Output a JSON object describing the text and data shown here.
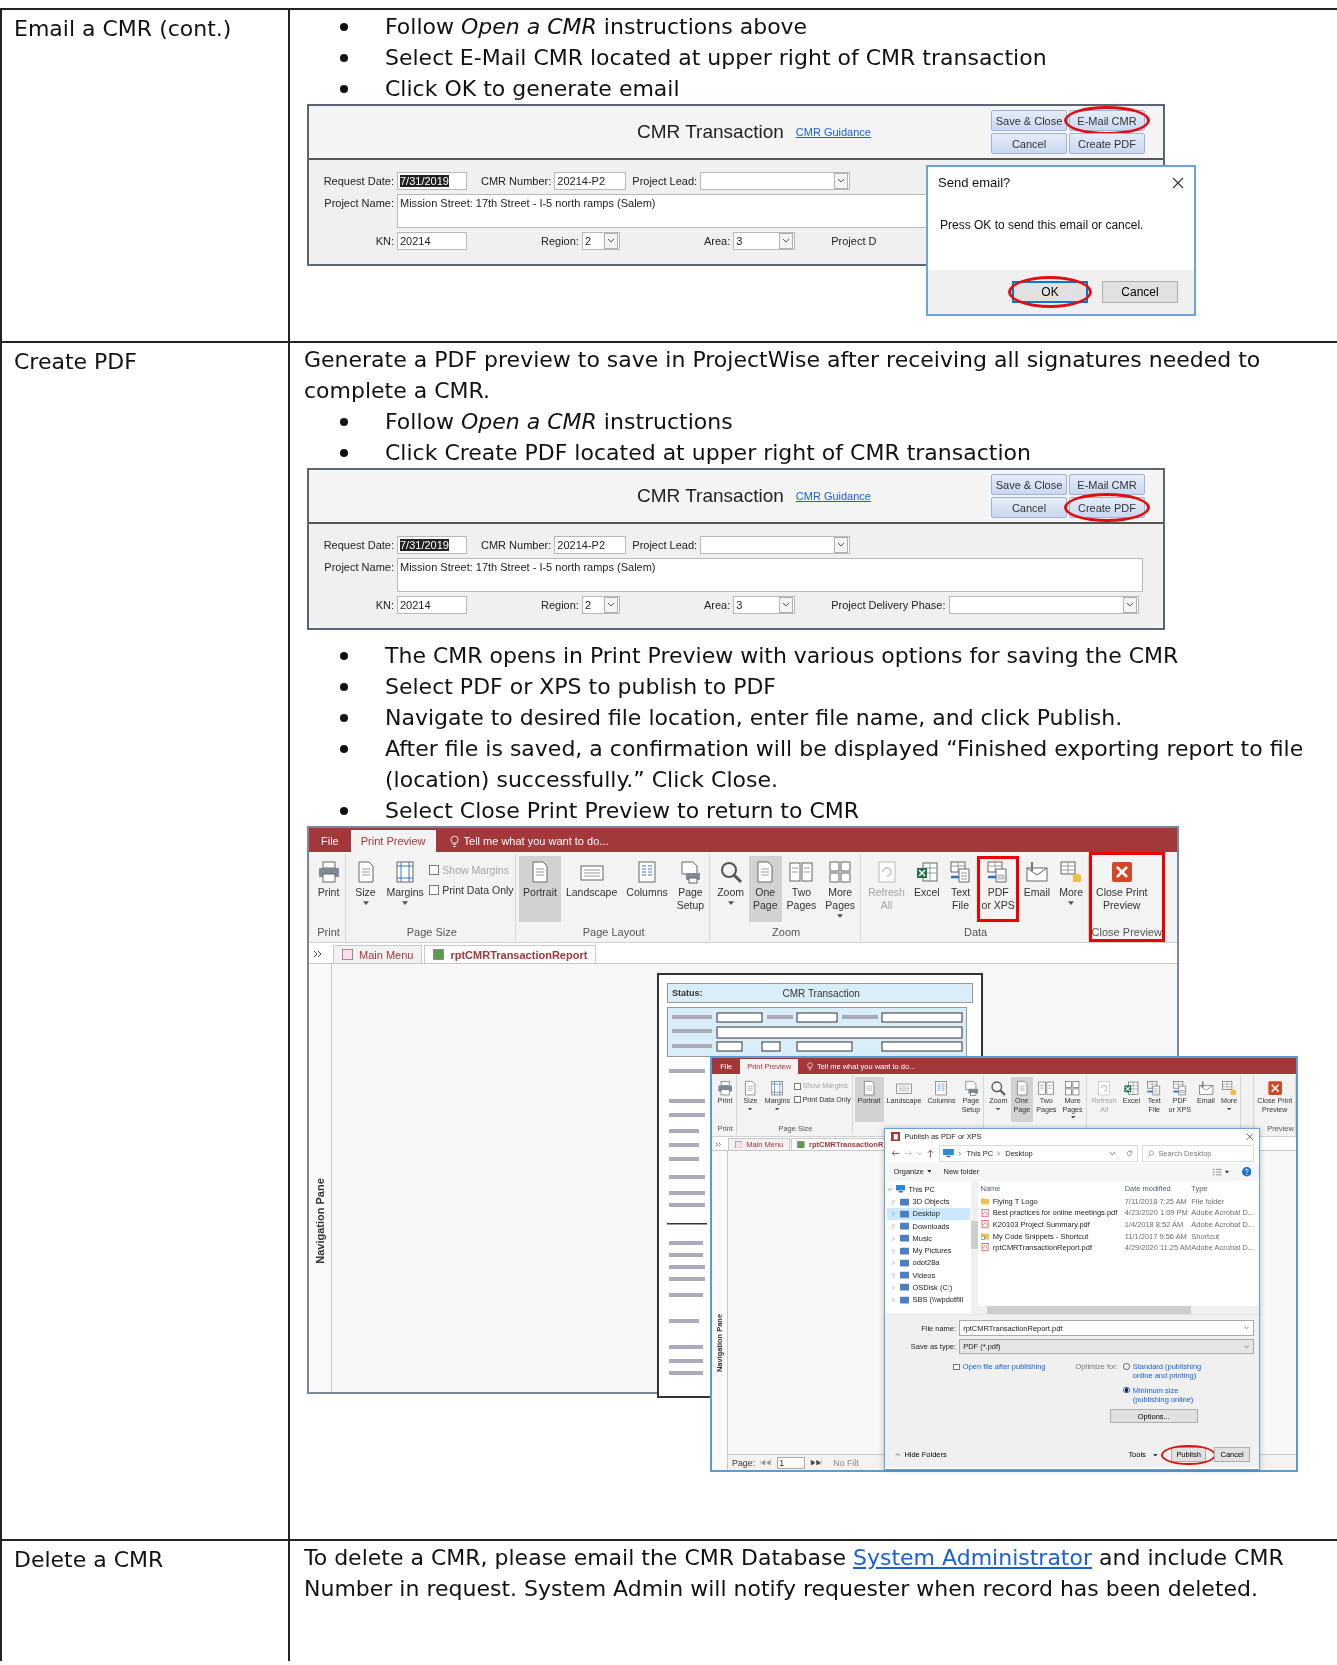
{
  "rows": [
    {
      "label": "Email a CMR (cont.)",
      "blocks": [
        {
          "kind": "bullets",
          "items": [
            "Follow *Open a CMR* instructions above",
            "Select E-Mail CMR located at upper right of CMR transaction",
            "Click OK to generate email"
          ]
        },
        {
          "kind": "form",
          "form": {
            "title": "CMR Transaction",
            "guidance": "CMR Guidance",
            "buttons": [
              {
                "label": "Save & Close",
                "circled": false
              },
              {
                "label": "E-Mail CMR",
                "circled": true
              },
              {
                "label": "Cancel",
                "circled": false
              },
              {
                "label": "Create PDF",
                "circled": false
              }
            ],
            "rows": [
              [
                {
                  "label": "Request Date:",
                  "kind": "text",
                  "value": "7/31/2019",
                  "selected": true
                },
                {
                  "label": "CMR Number:",
                  "kind": "text",
                  "value": "20214-P2",
                  "selected": false
                },
                {
                  "label": "Project Lead:",
                  "kind": "combo"
                }
              ],
              [
                {
                  "label": "Project Name:",
                  "kind": "memo",
                  "value": "Mission Street: 17th Street - I-5 north ramps (Salem)"
                }
              ],
              [
                {
                  "label": "KN:",
                  "kind": "text",
                  "value": "20214",
                  "selected": false
                },
                {
                  "label": "Region:",
                  "kind": "combo",
                  "value": "2"
                },
                {
                  "label": "Area:",
                  "kind": "combo",
                  "value": "3"
                },
                {
                  "label": "Project D",
                  "kind": "label"
                }
              ]
            ]
          },
          "dialog": {
            "title": "Send email?",
            "message": "Press OK to send this email or cancel.",
            "buttons": [
              {
                "label": "OK",
                "circled": true,
                "default": true
              },
              {
                "label": "Cancel",
                "circled": false,
                "default": false
              }
            ]
          }
        }
      ]
    },
    {
      "label": "Create PDF",
      "blocks": [
        {
          "kind": "paragraph",
          "text": "Generate a PDF preview to save in ProjectWise after receiving all signatures needed to complete a CMR."
        },
        {
          "kind": "bullets",
          "items": [
            "Follow *Open a CMR* instructions",
            "Click Create PDF located at upper right of CMR transaction"
          ]
        },
        {
          "kind": "form",
          "form": {
            "title": "CMR Transaction",
            "guidance": "CMR Guidance",
            "buttons": [
              {
                "label": "Save & Close",
                "circled": false
              },
              {
                "label": "E-Mail CMR",
                "circled": false
              },
              {
                "label": "Cancel",
                "circled": false
              },
              {
                "label": "Create PDF",
                "circled": true
              }
            ],
            "rows": [
              [
                {
                  "label": "Request Date:",
                  "kind": "text",
                  "value": "7/31/2019",
                  "selected": true
                },
                {
                  "label": "CMR Number:",
                  "kind": "text",
                  "value": "20214-P2",
                  "selected": false
                },
                {
                  "label": "Project Lead:",
                  "kind": "combo"
                }
              ],
              [
                {
                  "label": "Project Name:",
                  "kind": "memo",
                  "value": "Mission Street: 17th Street - I-5 north ramps (Salem)"
                }
              ],
              [
                {
                  "label": "KN:",
                  "kind": "text",
                  "value": "20214",
                  "selected": false
                },
                {
                  "label": "Region:",
                  "kind": "combo",
                  "value": "2"
                },
                {
                  "label": "Area:",
                  "kind": "combo",
                  "value": "3"
                },
                {
                  "label": "Project Delivery Phase:",
                  "kind": "combo"
                }
              ]
            ]
          }
        },
        {
          "kind": "bullets",
          "items": [
            "The CMR opens in Print Preview with various options for saving the CMR",
            "Select PDF or XPS to publish to PDF",
            "Navigate to desired file location, enter file name, and click Publish.",
            "After file is saved, a confirmation will be displayed “Finished exporting report to file (location) successfully.” Click Close.",
            "Select Close Print Preview to return to CMR"
          ]
        },
        {
          "kind": "preview",
          "windows": [
            {
              "tabs": [
                {
                  "label": "File",
                  "selected": false
                },
                {
                  "label": "Print Preview",
                  "selected": true
                }
              ],
              "tell_me": "Tell me what you want to do...",
              "groups": [
                {
                  "label": "Print",
                  "highlighted": false,
                  "buttons": [
                    {
                      "kind": "button",
                      "label": "Print",
                      "selected": false,
                      "disabled": false,
                      "highlighted": false,
                      "dropdown": false
                    }
                  ]
                },
                {
                  "label": "Page Size",
                  "highlighted": false,
                  "buttons": [
                    {
                      "kind": "button",
                      "label": "Size",
                      "selected": false,
                      "disabled": false,
                      "highlighted": false,
                      "dropdown": true
                    },
                    {
                      "kind": "button",
                      "label": "Margins",
                      "selected": false,
                      "disabled": false,
                      "highlighted": false,
                      "dropdown": true
                    },
                    {
                      "kind": "checkbox",
                      "label": "Show Margins",
                      "checked": false,
                      "disabled": true
                    },
                    {
                      "kind": "checkbox",
                      "label": "Print Data Only",
                      "checked": false,
                      "disabled": false
                    }
                  ]
                },
                {
                  "label": "Page Layout",
                  "highlighted": false,
                  "buttons": [
                    {
                      "kind": "button",
                      "label": "Portrait",
                      "selected": true,
                      "disabled": false,
                      "highlighted": false,
                      "dropdown": false
                    },
                    {
                      "kind": "button",
                      "label": "Landscape",
                      "selected": false,
                      "disabled": false,
                      "highlighted": false,
                      "dropdown": false
                    },
                    {
                      "kind": "button",
                      "label": "Columns",
                      "selected": false,
                      "disabled": false,
                      "highlighted": false,
                      "dropdown": false
                    },
                    {
                      "kind": "button",
                      "label": "Page\nSetup",
                      "selected": false,
                      "disabled": false,
                      "highlighted": false,
                      "dropdown": false
                    }
                  ]
                },
                {
                  "label": "Zoom",
                  "highlighted": false,
                  "buttons": [
                    {
                      "kind": "button",
                      "label": "Zoom",
                      "selected": false,
                      "disabled": false,
                      "highlighted": false,
                      "dropdown": true
                    },
                    {
                      "kind": "button",
                      "label": "One\nPage",
                      "selected": true,
                      "disabled": false,
                      "highlighted": false,
                      "dropdown": false
                    },
                    {
                      "kind": "button",
                      "label": "Two\nPages",
                      "selected": false,
                      "disabled": false,
                      "highlighted": false,
                      "dropdown": false
                    },
                    {
                      "kind": "button",
                      "label": "More\nPages",
                      "selected": false,
                      "disabled": false,
                      "highlighted": false,
                      "dropdown": true
                    }
                  ]
                },
                {
                  "label": "Data",
                  "highlighted": false,
                  "buttons": [
                    {
                      "kind": "button",
                      "label": "Refresh\nAll",
                      "selected": false,
                      "disabled": true,
                      "highlighted": false,
                      "dropdown": false
                    },
                    {
                      "kind": "button",
                      "label": "Excel",
                      "selected": false,
                      "disabled": false,
                      "highlighted": false,
                      "dropdown": false
                    },
                    {
                      "kind": "button",
                      "label": "Text\nFile",
                      "selected": false,
                      "disabled": false,
                      "highlighted": false,
                      "dropdown": false
                    },
                    {
                      "kind": "button",
                      "label": "PDF\nor XPS",
                      "selected": false,
                      "disabled": false,
                      "highlighted": true,
                      "dropdown": false
                    },
                    {
                      "kind": "button",
                      "label": "Email",
                      "selected": false,
                      "disabled": false,
                      "highlighted": false,
                      "dropdown": false
                    },
                    {
                      "kind": "button",
                      "label": "More",
                      "selected": false,
                      "disabled": false,
                      "highlighted": false,
                      "dropdown": true
                    }
                  ]
                },
                {
                  "label": "Close Preview",
                  "highlighted": true,
                  "buttons": [
                    {
                      "kind": "button",
                      "label": "Close Print\nPreview",
                      "selected": false,
                      "disabled": false,
                      "highlighted": false,
                      "dropdown": false
                    }
                  ]
                }
              ],
              "doc_tabs": [
                {
                  "label": "Main Menu",
                  "selected": false
                },
                {
                  "label": "rptCMRTransactionReport",
                  "selected": true
                }
              ],
              "nav_label": "Navigation Pane",
              "report": {
                "status_label": "Status:",
                "title": "CMR Transaction"
              }
            },
            {
              "tabs": [
                {
                  "label": "File",
                  "selected": false
                },
                {
                  "label": "Print Preview",
                  "selected": true
                }
              ],
              "tell_me": "Tell me what you want to do...",
              "groups": [
                {
                  "label": "Print",
                  "highlighted": false,
                  "buttons": [
                    {
                      "kind": "button",
                      "label": "Print",
                      "selected": false,
                      "disabled": false,
                      "highlighted": false,
                      "dropdown": false
                    }
                  ]
                },
                {
                  "label": "Page Size",
                  "highlighted": false,
                  "buttons": [
                    {
                      "kind": "button",
                      "label": "Size",
                      "selected": false,
                      "disabled": false,
                      "highlighted": false,
                      "dropdown": true
                    },
                    {
                      "kind": "button",
                      "label": "Margins",
                      "selected": false,
                      "disabled": false,
                      "highlighted": false,
                      "dropdown": true
                    },
                    {
                      "kind": "checkbox",
                      "label": "Show Margins",
                      "checked": false,
                      "disabled": true
                    },
                    {
                      "kind": "checkbox",
                      "label": "Print Data Only",
                      "checked": false,
                      "disabled": false
                    }
                  ]
                },
                {
                  "highlighted": false,
                  "buttons": [
                    {
                      "kind": "button",
                      "label": "Portrait",
                      "selected": true,
                      "disabled": false,
                      "highlighted": false,
                      "dropdown": false
                    },
                    {
                      "kind": "button",
                      "label": "Landscape",
                      "selected": false,
                      "disabled": false,
                      "highlighted": false,
                      "dropdown": false
                    },
                    {
                      "kind": "button",
                      "label": "Columns",
                      "selected": false,
                      "disabled": false,
                      "highlighted": false,
                      "dropdown": false
                    },
                    {
                      "kind": "button",
                      "label": "Page\nSetup",
                      "selected": false,
                      "disabled": false,
                      "highlighted": false,
                      "dropdown": false
                    }
                  ]
                },
                {
                  "highlighted": false,
                  "buttons": [
                    {
                      "kind": "button",
                      "label": "Zoom",
                      "selected": false,
                      "disabled": false,
                      "highlighted": false,
                      "dropdown": true
                    },
                    {
                      "kind": "button",
                      "label": "One\nPage",
                      "selected": true,
                      "disabled": false,
                      "highlighted": false,
                      "dropdown": false
                    },
                    {
                      "kind": "button",
                      "label": "Two\nPages",
                      "selected": false,
                      "disabled": false,
                      "highlighted": false,
                      "dropdown": false
                    },
                    {
                      "kind": "button",
                      "label": "More\nPages",
                      "selected": false,
                      "disabled": false,
                      "highlighted": false,
                      "dropdown": true
                    }
                  ]
                },
                {
                  "highlighted": false,
                  "buttons": [
                    {
                      "kind": "button",
                      "label": "Refresh\nAll",
                      "selected": false,
                      "disabled": true,
                      "highlighted": false,
                      "dropdown": false
                    },
                    {
                      "kind": "button",
                      "label": "Excel",
                      "selected": false,
                      "disabled": false,
                      "highlighted": false,
                      "dropdown": false
                    },
                    {
                      "kind": "button",
                      "label": "Text\nFile",
                      "selected": false,
                      "disabled": false,
                      "highlighted": false,
                      "dropdown": false
                    },
                    {
                      "kind": "button",
                      "label": "PDF\nor XPS",
                      "selected": false,
                      "disabled": false,
                      "highlighted": false,
                      "dropdown": false
                    },
                    {
                      "kind": "button",
                      "label": "Email",
                      "selected": false,
                      "disabled": false,
                      "highlighted": false,
                      "dropdown": false
                    },
                    {
                      "kind": "button",
                      "label": "More",
                      "selected": false,
                      "disabled": false,
                      "highlighted": false,
                      "dropdown": true
                    }
                  ]
                },
                {
                  "label": "Preview",
                  "highlighted": false,
                  "buttons": [
                    {
                      "kind": "button",
                      "label": "Close Print\nPreview",
                      "selected": false,
                      "disabled": false,
                      "highlighted": false,
                      "dropdown": false
                    }
                  ]
                }
              ],
              "doc_tabs": [
                {
                  "label": "Main Menu",
                  "selected": false
                },
                {
                  "label": "rptCMRTransactionR",
                  "selected": true
                }
              ],
              "nav_label": "Navigation Pane",
              "status": {
                "page_label": "Page:",
                "page": "1",
                "filter": "No Filt"
              },
              "dialog": {
                "title": "Publish as PDF or XPS",
                "path": [
                  "This PC",
                  "Desktop"
                ],
                "search_placeholder": "Search Desktop",
                "organize": "Organize",
                "new_folder": "New folder",
                "tree": [
                  {
                    "label": "This PC",
                    "expanded": true,
                    "selected": false,
                    "children": [
                      {
                        "label": "3D Objects",
                        "expanded": false,
                        "selected": false
                      },
                      {
                        "label": "Desktop",
                        "expanded": false,
                        "selected": true
                      },
                      {
                        "label": "Downloads",
                        "expanded": false,
                        "selected": false
                      },
                      {
                        "label": "Music",
                        "expanded": false,
                        "selected": false
                      },
                      {
                        "label": "My Pictures",
                        "expanded": false,
                        "selected": false
                      },
                      {
                        "label": "odot28a",
                        "expanded": false,
                        "selected": false
                      },
                      {
                        "label": "Videos",
                        "expanded": false,
                        "selected": false
                      },
                      {
                        "label": "OSDisk (C:)",
                        "expanded": false,
                        "selected": false
                      },
                      {
                        "label": "SBS (\\\\wpdotfill",
                        "expanded": false,
                        "selected": false
                      }
                    ]
                  }
                ],
                "columns": [
                  "Name",
                  "Date modified",
                  "Type"
                ],
                "files": [
                  {
                    "kind": "folder",
                    "name": "Flying T Logo",
                    "date": "7/11/2018 7:25 AM",
                    "type": "File folder"
                  },
                  {
                    "kind": "pdf",
                    "name": "Best practices for online meetings.pdf",
                    "date": "4/23/2020 1:09 PM",
                    "type": "Adobe Acrobat D..."
                  },
                  {
                    "kind": "pdf",
                    "name": "K20103 Project Summary.pdf",
                    "date": "1/4/2018 8:52 AM",
                    "type": "Adobe Acrobat D..."
                  },
                  {
                    "kind": "shortcut",
                    "name": "My Code Snippets - Shortcut",
                    "date": "11/1/2017 9:56 AM",
                    "type": "Shortcut"
                  },
                  {
                    "kind": "pdf",
                    "name": "rptCMRTransactionReport.pdf",
                    "date": "4/29/2020 11:25 AM",
                    "type": "Adobe Acrobat D..."
                  }
                ],
                "file_name_label": "File name:",
                "file_name": "rptCMRTransactionReport.pdf",
                "save_type_label": "Save as type:",
                "save_type": "PDF (*.pdf)",
                "open_after": {
                  "label": "Open file after publishing",
                  "checked": false
                },
                "optimize_label": "Optimize for:",
                "optimize": [
                  {
                    "label": "Standard (publishing online and printing)",
                    "selected": false
                  },
                  {
                    "label": "Minimum size (publishing online)",
                    "selected": true
                  }
                ],
                "options_button": "Options...",
                "hide_folders": "Hide Folders",
                "tools": "Tools",
                "buttons": [
                  {
                    "label": "Publish",
                    "circled": true
                  },
                  {
                    "label": "Cancel",
                    "circled": false
                  }
                ]
              }
            }
          ]
        }
      ]
    },
    {
      "label": "Delete a CMR",
      "blocks": [
        {
          "kind": "link_paragraph",
          "before": "To delete a CMR, please email the CMR Database ",
          "link": "System Administrator",
          "after": " and include CMR Number in request. System Admin will notify requester when record has been deleted."
        }
      ]
    }
  ]
}
